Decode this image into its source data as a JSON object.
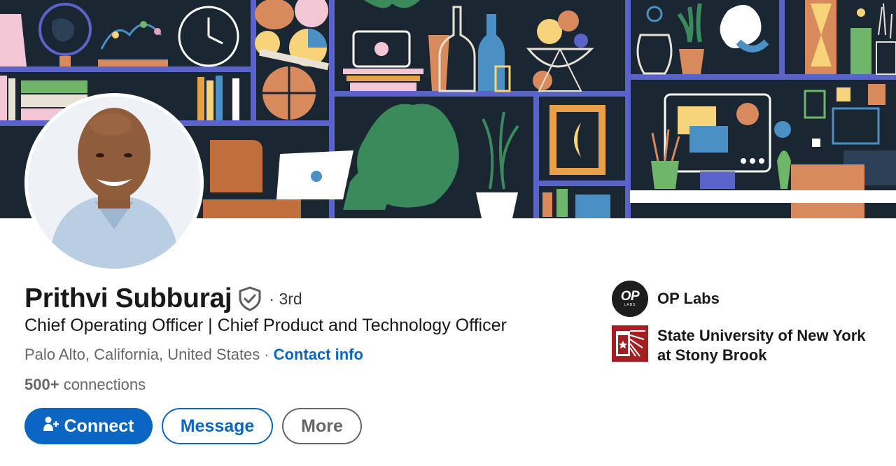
{
  "profile": {
    "name": "Prithvi Subburaj",
    "degree": "· 3rd",
    "headline": "Chief Operating Officer | Chief Product and Technology Officer",
    "location": "Palo Alto, California, United States",
    "separator": "·",
    "contact_label": "Contact info",
    "connections_count": "500+",
    "connections_label": "connections"
  },
  "actions": {
    "connect_label": "Connect",
    "message_label": "Message",
    "more_label": "More"
  },
  "sidebar": {
    "company": {
      "name": "OP Labs",
      "logo_text": "OP",
      "logo_subtext": "LABS"
    },
    "education": {
      "name": "State University of New York at Stony Brook"
    }
  },
  "icons": {
    "verified": "shield-check-icon",
    "connect": "add-person-icon"
  },
  "colors": {
    "primary": "#0a66c2",
    "banner_bg": "#1b2633",
    "shelf": "#5a63c8",
    "sbu_red": "#a41e22"
  }
}
